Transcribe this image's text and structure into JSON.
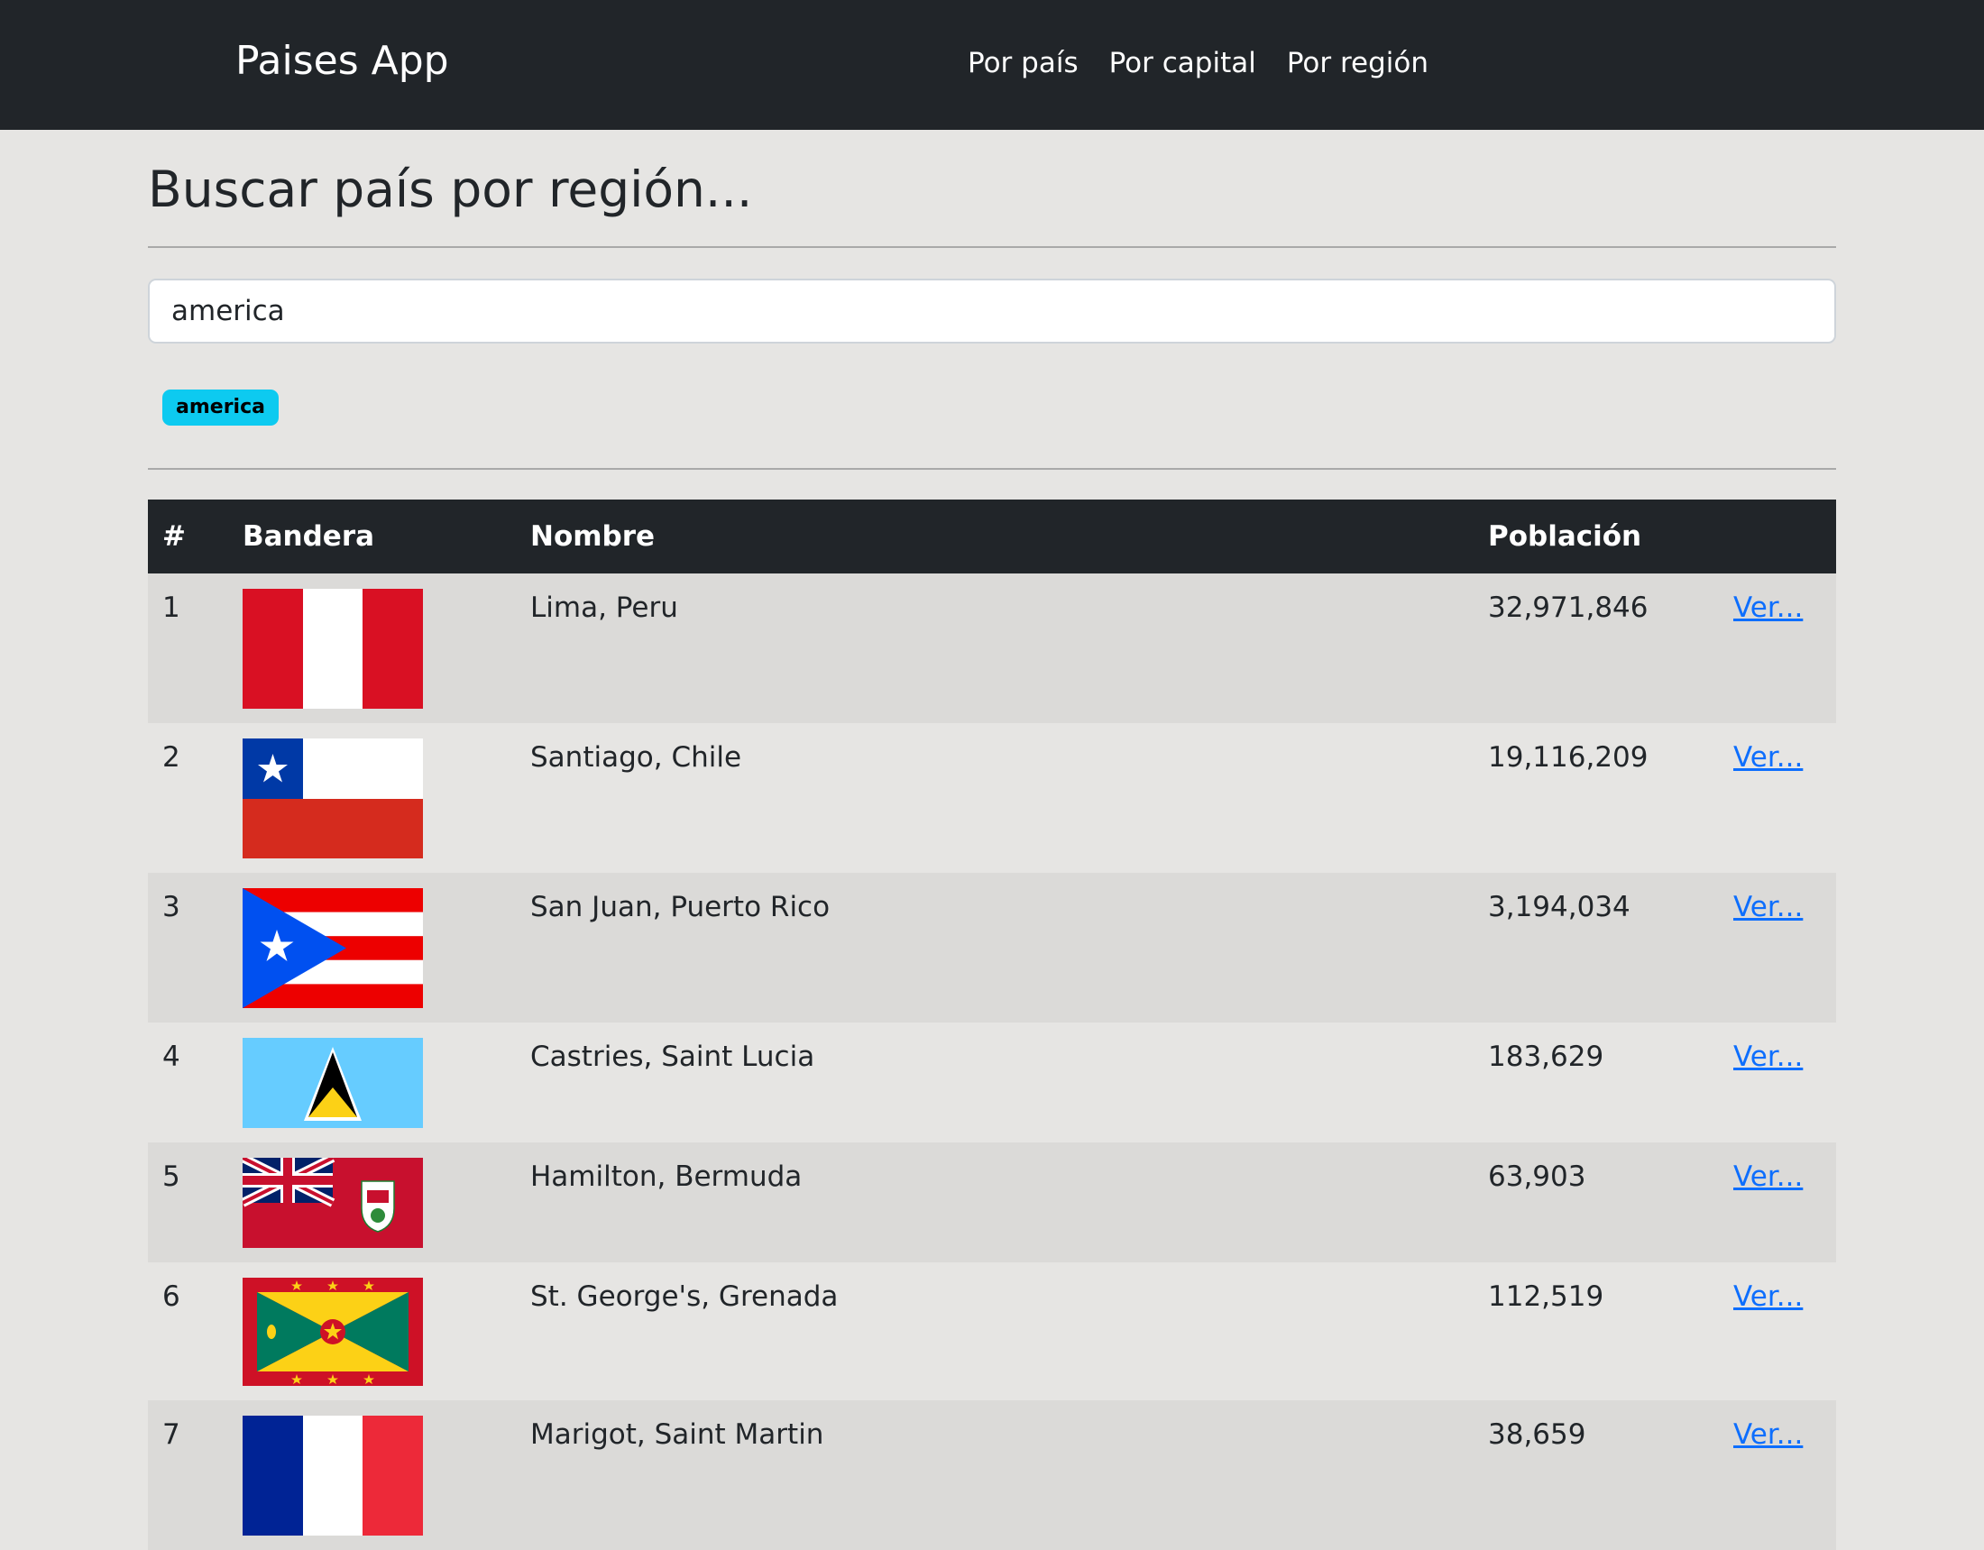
{
  "navbar": {
    "brand": "Paises App",
    "links": [
      "Por país",
      "Por capital",
      "Por región"
    ]
  },
  "page": {
    "title": "Buscar país por región...",
    "search_value": "america",
    "active_badge": "america"
  },
  "table": {
    "headers": [
      "#",
      "Bandera",
      "Nombre",
      "Población",
      ""
    ],
    "rows": [
      {
        "num": "1",
        "name": "Lima, Peru",
        "population": "32,971,846",
        "link": "Ver...",
        "flag": "peru-flag"
      },
      {
        "num": "2",
        "name": "Santiago, Chile",
        "population": "19,116,209",
        "link": "Ver...",
        "flag": "chile-flag"
      },
      {
        "num": "3",
        "name": "San Juan, Puerto Rico",
        "population": "3,194,034",
        "link": "Ver...",
        "flag": "puerto-rico-flag"
      },
      {
        "num": "4",
        "name": "Castries, Saint Lucia",
        "population": "183,629",
        "link": "Ver...",
        "flag": "saint-lucia-flag"
      },
      {
        "num": "5",
        "name": "Hamilton, Bermuda",
        "population": "63,903",
        "link": "Ver...",
        "flag": "bermuda-flag"
      },
      {
        "num": "6",
        "name": "St. George's, Grenada",
        "population": "112,519",
        "link": "Ver...",
        "flag": "grenada-flag"
      },
      {
        "num": "7",
        "name": "Marigot, Saint Martin",
        "population": "38,659",
        "link": "Ver...",
        "flag": "saint-martin-flag"
      }
    ]
  }
}
